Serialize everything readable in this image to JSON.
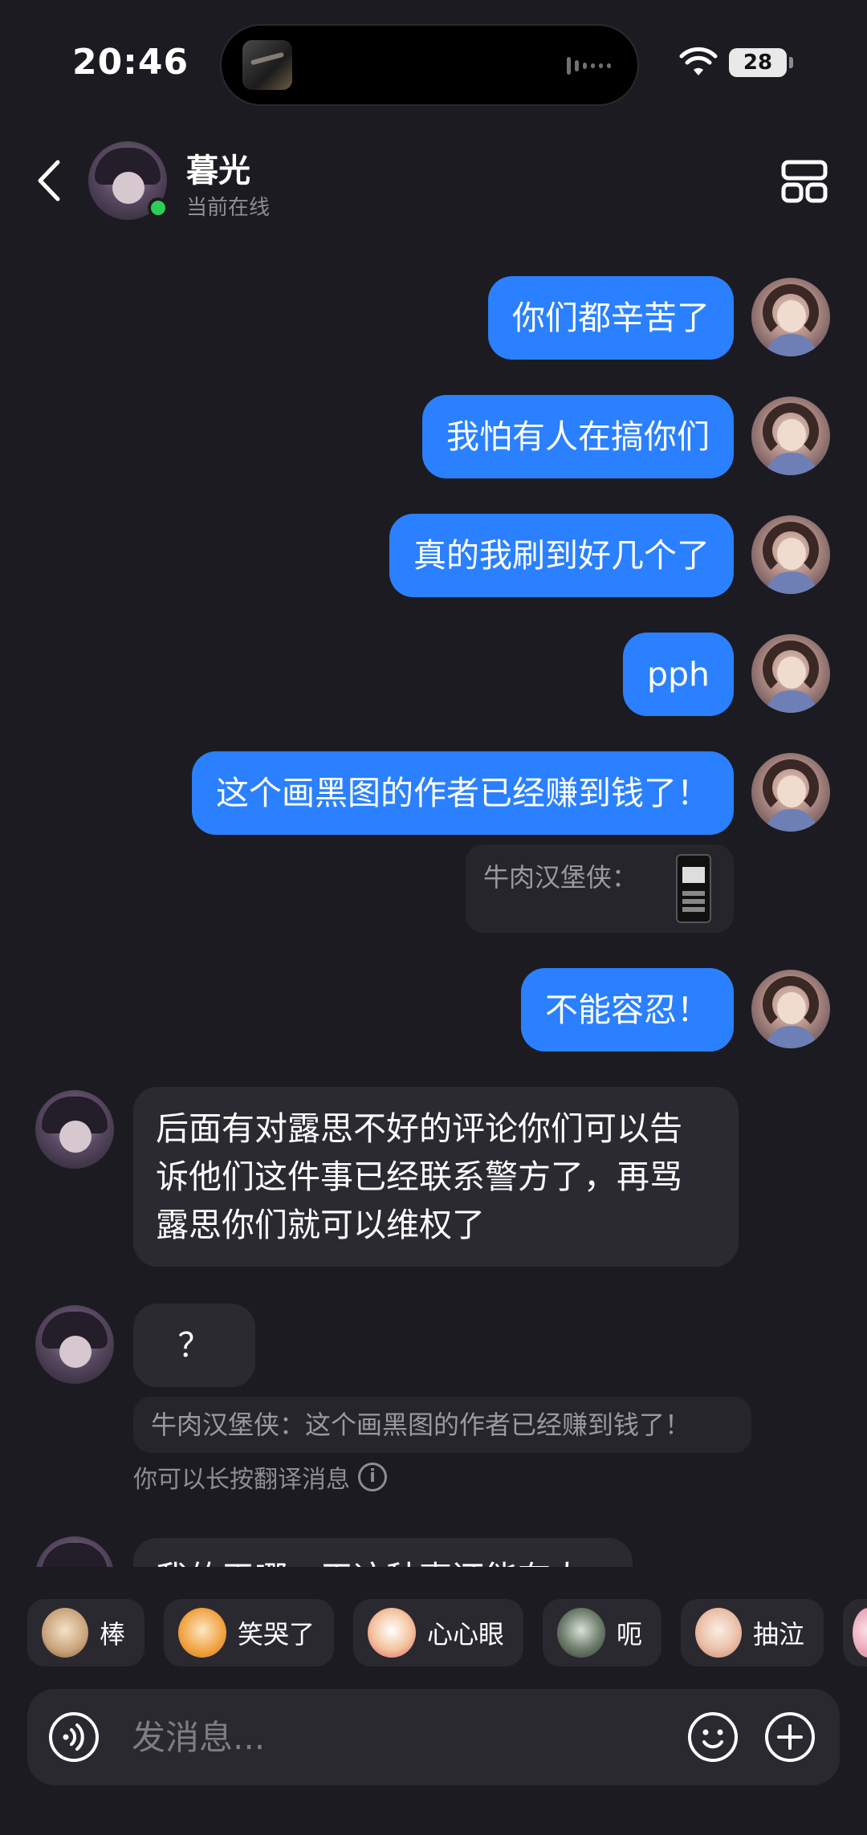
{
  "status_bar": {
    "time": "20:46",
    "battery": "28"
  },
  "header": {
    "name": "暮光",
    "status": "当前在线"
  },
  "messages": {
    "m1": "你们都辛苦了",
    "m2": "我怕有人在搞你们",
    "m3": "真的我刷到好几个了",
    "m4": "pph",
    "m5": "这个画黑图的作者已经赚到钱了！",
    "m5_quote": "牛肉汉堡侠：",
    "m6": "不能容忍！",
    "r1_line1": "后面有对露思不好的评论你们可以告",
    "r1_line2": "诉他们这件事已经联系警方了，再骂",
    "r1_line3": "露思你们就可以维权了",
    "r2": "？",
    "r2_quote": "牛肉汉堡侠：这个画黑图的作者已经赚到钱了！",
    "hint": "你可以长按翻译消息",
    "partial": "我的天哪，天这种事还能有人"
  },
  "stickers": [
    {
      "label": "棒",
      "icon": "cat-thumbs-up-icon"
    },
    {
      "label": "笑哭了",
      "icon": "dog-laugh-cry-icon"
    },
    {
      "label": "心心眼",
      "icon": "dog-heart-eyes-icon"
    },
    {
      "label": "呃",
      "icon": "cat-speechless-icon"
    },
    {
      "label": "抽泣",
      "icon": "cat-sob-icon"
    }
  ],
  "input": {
    "placeholder": "发消息..."
  },
  "colors": {
    "background": "#1c1b21",
    "outgoing_bubble": "#2a80ff",
    "incoming_bubble": "#2b2a31",
    "online": "#2dce58"
  }
}
